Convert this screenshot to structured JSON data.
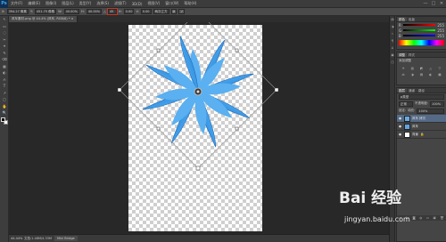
{
  "app": {
    "logo": "Ps"
  },
  "menu": [
    "文件(F)",
    "编辑(E)",
    "图像(I)",
    "图层(L)",
    "类型(Y)",
    "选择(S)",
    "滤镜(T)",
    "3D(D)",
    "视图(V)",
    "窗口(W)",
    "帮助(H)"
  ],
  "window_controls": [
    "—",
    "□",
    "✕"
  ],
  "options": {
    "x_label": "X:",
    "x_value": "394.27 像素",
    "y_label": "Y:",
    "y_value": "451.75 像素",
    "w_label": "W:",
    "w_value": "40.00%",
    "h_label": "H:",
    "h_value": "40.00%",
    "angle_label": "△",
    "angle_value": "45",
    "h_skew_label": "H:",
    "h_skew_value": "0.00",
    "v_skew_label": "V:",
    "v_skew_value": "0.00",
    "interp_value": "两次立方",
    "cancel": "⊘",
    "commit": "✓"
  },
  "tools": [
    "↖",
    "▭",
    "◌",
    "✂",
    "⌖",
    "✎",
    "⌫",
    "▦",
    "◐",
    "✍",
    "T",
    "↗",
    "▢",
    "✋",
    "🔍"
  ],
  "document": {
    "tab_title": "风车素材.png @ 44.4% (风车, RGB/8) *",
    "close": "×"
  },
  "status": {
    "zoom": "44.44%",
    "doc_info": "文档:1.48M/4.33M",
    "tab": "Mini Bridge"
  },
  "dock_icons": [
    "▤",
    "◑",
    "⌗",
    "¶",
    "A",
    "▣",
    "◫"
  ],
  "color_panel": {
    "tabs": [
      "颜色",
      "色板"
    ],
    "channels": [
      {
        "name": "R",
        "value": "255",
        "gradient": "linear-gradient(90deg,#000,#f00)"
      },
      {
        "name": "G",
        "value": "255",
        "gradient": "linear-gradient(90deg,#000,#0f0)"
      },
      {
        "name": "B",
        "value": "255",
        "gradient": "linear-gradient(90deg,#000,#00f)"
      }
    ]
  },
  "adjust_panel": {
    "tabs": [
      "调整",
      "样式"
    ],
    "label": "添加调整",
    "icons": [
      "☀",
      "▥",
      "◩",
      "△",
      "▽",
      "⚖",
      "◑",
      "▤",
      "◐",
      "▦"
    ]
  },
  "layers_panel": {
    "tabs": [
      "图层",
      "通道",
      "路径"
    ],
    "kind_filter": "ρ类型",
    "blend_mode": "正常",
    "opacity_label": "不透明度:",
    "opacity_value": "100%",
    "lock_label": "锁定:",
    "fill_label": "填充:",
    "fill_value": "100%",
    "layers": [
      {
        "name": "风车 拷贝",
        "selected": true,
        "thumb_color": "#6aa8e0"
      },
      {
        "name": "风车",
        "selected": false,
        "thumb_color": "#5fa3e6"
      },
      {
        "name": "背景",
        "selected": false,
        "thumb_color": "#ffffff",
        "lock": "🔒"
      }
    ],
    "footer_icons": [
      "∞",
      "fx",
      "◙",
      "◍",
      "▭",
      "▣",
      "🗑"
    ]
  },
  "watermark": {
    "logo": "Bai 经验",
    "url": "jingyan.baidu.com"
  },
  "colors": {
    "pinwheel": "#3f9be6",
    "pinwheel_dark": "#1f6fbf",
    "pinwheel_light": "#8fd0ff",
    "highlight": "#c0392b"
  }
}
